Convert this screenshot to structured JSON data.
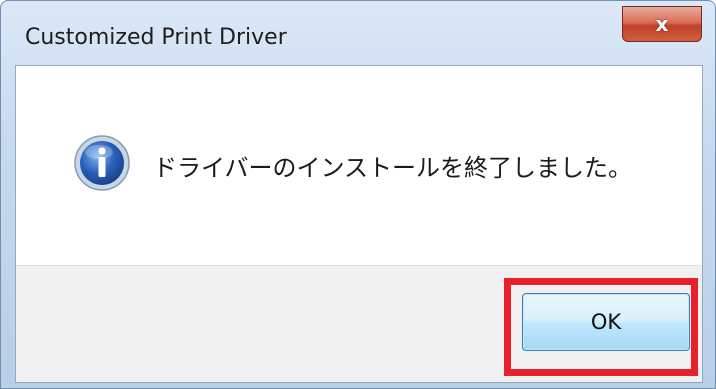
{
  "window": {
    "title": "Customized Print Driver",
    "close_label": "x"
  },
  "message": {
    "icon": "info-icon",
    "text": "ドライバーのインストールを終了しました。"
  },
  "buttons": {
    "ok_label": "OK"
  },
  "colors": {
    "highlight": "#e8202a",
    "info_icon": "#2a5fb8",
    "close_button": "#c0412a"
  }
}
